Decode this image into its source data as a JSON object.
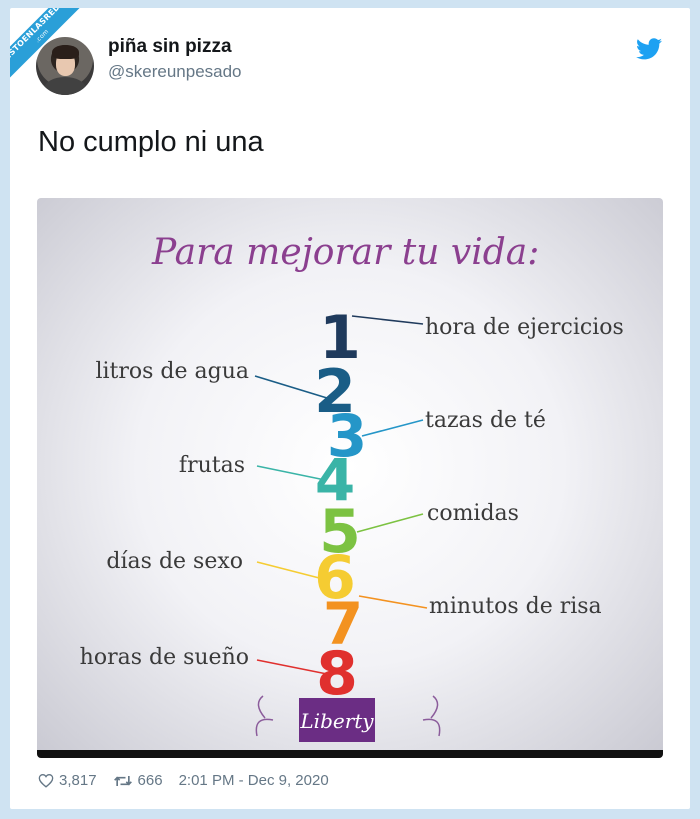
{
  "watermark": {
    "line1": "VISTOENLASREDES",
    "line2": ".com"
  },
  "author": {
    "display_name": "piña sin pizza",
    "handle": "@skereunpesado"
  },
  "tweet": {
    "text": "No cumplo ni una"
  },
  "image": {
    "title": "Para mejorar tu vida:",
    "brand": "Liberty",
    "items": [
      {
        "number": "1",
        "label": "hora de ejercicios",
        "color": "#1f3a5c"
      },
      {
        "number": "2",
        "label": "litros de agua",
        "color": "#1a5d86"
      },
      {
        "number": "3",
        "label": "tazas de té",
        "color": "#2596c8"
      },
      {
        "number": "4",
        "label": "frutas",
        "color": "#3ab4a7"
      },
      {
        "number": "5",
        "label": "comidas",
        "color": "#7cc242"
      },
      {
        "number": "6",
        "label": "días de sexo",
        "color": "#f5cc32"
      },
      {
        "number": "7",
        "label": "minutos de risa",
        "color": "#f39220"
      },
      {
        "number": "8",
        "label": "horas de sueño",
        "color": "#e0302e"
      }
    ]
  },
  "footer": {
    "likes": "3,817",
    "retweets": "666",
    "timestamp": "2:01 PM - Dec 9, 2020"
  },
  "colors": {
    "twitter_blue": "#1da1f2",
    "title_purple": "#8b3f8f",
    "brand_purple": "#6b2d84"
  }
}
